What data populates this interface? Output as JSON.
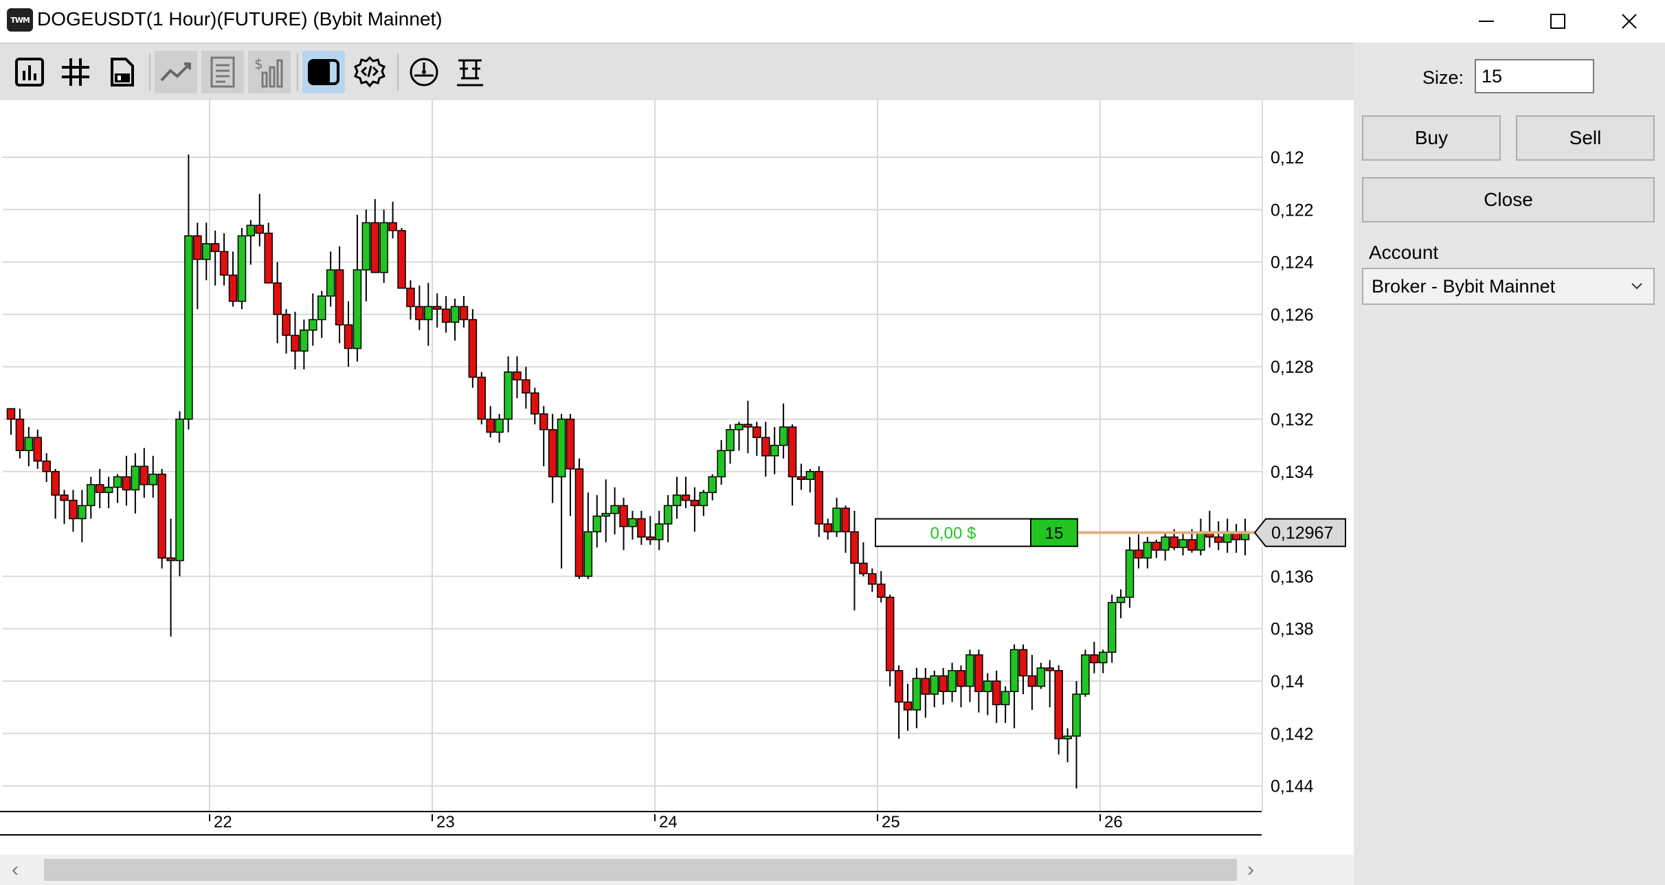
{
  "window": {
    "logo_text": "TWM",
    "title": "DOGEUSDT(1 Hour)(FUTURE) (Bybit Mainnet)"
  },
  "toolbar": {
    "buttons": [
      "bar-chart-icon",
      "grid-icon",
      "save-template-icon",
      "indicators-icon",
      "report-icon",
      "dollar-volume-icon",
      "panel-toggle-icon",
      "code-settings-icon",
      "speedometer-icon",
      "strategy-icon"
    ]
  },
  "chart": {
    "price_levels": [
      "0,144",
      "0,142",
      "0,14",
      "0,138",
      "0,136",
      "0,134",
      "0,132",
      "0,128",
      "0,126",
      "0,124",
      "0,122",
      "0,12"
    ],
    "current_price": "0,12967",
    "position": {
      "pnl": "0,00 $",
      "size": "15"
    },
    "colors": {
      "up": "#22c422",
      "down": "#e01010",
      "position_line": "#e0b080",
      "pnl_text": "#22c422"
    }
  },
  "chart_data": {
    "type": "candlestick",
    "instrument": "DOGEUSDT(1 Hour)(FUTURE)",
    "x_ticks": [
      "22",
      "23",
      "24",
      "25",
      "26"
    ],
    "ylim": [
      0.119,
      0.145
    ],
    "y_ticks": [
      0.12,
      0.122,
      0.124,
      0.126,
      0.128,
      0.132,
      0.134,
      0.136,
      0.138,
      0.14,
      0.142,
      0.144
    ],
    "last_price": 0.12967,
    "candles": [
      [
        0.1344,
        0.1344,
        0.1334,
        0.134
      ],
      [
        0.134,
        0.1344,
        0.1325,
        0.1328
      ],
      [
        0.1328,
        0.1337,
        0.1322,
        0.1333
      ],
      [
        0.1333,
        0.1336,
        0.1321,
        0.1324
      ],
      [
        0.1324,
        0.1327,
        0.1316,
        0.132
      ],
      [
        0.132,
        0.1321,
        0.1302,
        0.1311
      ],
      [
        0.1311,
        0.1313,
        0.13,
        0.1309
      ],
      [
        0.1309,
        0.1313,
        0.1297,
        0.1302
      ],
      [
        0.1302,
        0.1313,
        0.1293,
        0.1307
      ],
      [
        0.1307,
        0.1318,
        0.1302,
        0.1315
      ],
      [
        0.1315,
        0.1321,
        0.1306,
        0.1312
      ],
      [
        0.1312,
        0.1318,
        0.1306,
        0.1314
      ],
      [
        0.1314,
        0.1319,
        0.1308,
        0.1318
      ],
      [
        0.1318,
        0.1326,
        0.1307,
        0.1313
      ],
      [
        0.1313,
        0.1327,
        0.1304,
        0.1322
      ],
      [
        0.1322,
        0.1329,
        0.131,
        0.1315
      ],
      [
        0.1315,
        0.1326,
        0.131,
        0.1319
      ],
      [
        0.1319,
        0.1321,
        0.1283,
        0.1287
      ],
      [
        0.1287,
        0.1302,
        0.1257,
        0.1286
      ],
      [
        0.1286,
        0.1343,
        0.128,
        0.134
      ],
      [
        0.134,
        0.1441,
        0.1336,
        0.141
      ],
      [
        0.141,
        0.1415,
        0.1382,
        0.1401
      ],
      [
        0.1401,
        0.1415,
        0.1393,
        0.1407
      ],
      [
        0.1407,
        0.1412,
        0.1391,
        0.1404
      ],
      [
        0.1404,
        0.1411,
        0.1391,
        0.1395
      ],
      [
        0.1395,
        0.1404,
        0.1383,
        0.1385
      ],
      [
        0.1385,
        0.1413,
        0.1382,
        0.141
      ],
      [
        0.141,
        0.1416,
        0.1399,
        0.1414
      ],
      [
        0.1414,
        0.1426,
        0.1406,
        0.1411
      ],
      [
        0.1411,
        0.1415,
        0.1392,
        0.1392
      ],
      [
        0.1392,
        0.14,
        0.1369,
        0.138
      ],
      [
        0.138,
        0.1382,
        0.1365,
        0.1372
      ],
      [
        0.1372,
        0.1381,
        0.1359,
        0.1366
      ],
      [
        0.1366,
        0.1378,
        0.1359,
        0.1374
      ],
      [
        0.1374,
        0.1388,
        0.1368,
        0.1378
      ],
      [
        0.1378,
        0.1389,
        0.1371,
        0.1387
      ],
      [
        0.1387,
        0.1404,
        0.1383,
        0.1397
      ],
      [
        0.1397,
        0.1406,
        0.1369,
        0.1376
      ],
      [
        0.1376,
        0.1385,
        0.136,
        0.1367
      ],
      [
        0.1367,
        0.1418,
        0.1362,
        0.1397
      ],
      [
        0.1397,
        0.142,
        0.1385,
        0.1415
      ],
      [
        0.1415,
        0.1424,
        0.1406,
        0.1396
      ],
      [
        0.1396,
        0.142,
        0.1392,
        0.1415
      ],
      [
        0.1415,
        0.1423,
        0.1409,
        0.1412
      ],
      [
        0.1412,
        0.1413,
        0.139,
        0.139
      ],
      [
        0.139,
        0.1393,
        0.1378,
        0.1383
      ],
      [
        0.1383,
        0.1391,
        0.1374,
        0.1378
      ],
      [
        0.1378,
        0.1392,
        0.1368,
        0.1383
      ],
      [
        0.1383,
        0.1388,
        0.1375,
        0.1382
      ],
      [
        0.1382,
        0.1387,
        0.1373,
        0.1377
      ],
      [
        0.1377,
        0.1386,
        0.137,
        0.1383
      ],
      [
        0.1383,
        0.1387,
        0.1375,
        0.1378
      ],
      [
        0.1378,
        0.1382,
        0.1352,
        0.1356
      ],
      [
        0.1356,
        0.1358,
        0.1338,
        0.134
      ],
      [
        0.134,
        0.1345,
        0.1333,
        0.1335
      ],
      [
        0.1335,
        0.1342,
        0.1331,
        0.134
      ],
      [
        0.134,
        0.1364,
        0.1335,
        0.1358
      ],
      [
        0.1358,
        0.1364,
        0.1348,
        0.1355
      ],
      [
        0.1355,
        0.136,
        0.1344,
        0.135
      ],
      [
        0.135,
        0.1352,
        0.1338,
        0.1342
      ],
      [
        0.1342,
        0.1345,
        0.1322,
        0.1336
      ],
      [
        0.1336,
        0.1342,
        0.1308,
        0.1318
      ],
      [
        0.1318,
        0.1342,
        0.1283,
        0.134
      ],
      [
        0.134,
        0.1342,
        0.1303,
        0.1321
      ],
      [
        0.1321,
        0.1325,
        0.1279,
        0.128
      ],
      [
        0.128,
        0.1312,
        0.1279,
        0.1297
      ],
      [
        0.1297,
        0.1311,
        0.1291,
        0.1303
      ],
      [
        0.1303,
        0.1317,
        0.1293,
        0.1304
      ],
      [
        0.1304,
        0.1314,
        0.1296,
        0.1307
      ],
      [
        0.1307,
        0.131,
        0.129,
        0.1299
      ],
      [
        0.1299,
        0.1305,
        0.1294,
        0.1302
      ],
      [
        0.1302,
        0.1305,
        0.1292,
        0.1295
      ],
      [
        0.1295,
        0.1303,
        0.1292,
        0.1294
      ],
      [
        0.1294,
        0.1305,
        0.129,
        0.13
      ],
      [
        0.13,
        0.1311,
        0.1293,
        0.1307
      ],
      [
        0.1307,
        0.1318,
        0.1302,
        0.1311
      ],
      [
        0.1311,
        0.1318,
        0.1306,
        0.1309
      ],
      [
        0.1309,
        0.1314,
        0.1297,
        0.1307
      ],
      [
        0.1307,
        0.1313,
        0.1303,
        0.1312
      ],
      [
        0.1312,
        0.1319,
        0.1309,
        0.1318
      ],
      [
        0.1318,
        0.1332,
        0.1315,
        0.1328
      ],
      [
        0.1328,
        0.1338,
        0.1323,
        0.1336
      ],
      [
        0.1336,
        0.1339,
        0.1328,
        0.1338
      ],
      [
        0.1338,
        0.1347,
        0.1327,
        0.1337
      ],
      [
        0.1337,
        0.1339,
        0.1326,
        0.1333
      ],
      [
        0.1333,
        0.1339,
        0.1318,
        0.1326
      ],
      [
        0.1326,
        0.1337,
        0.1319,
        0.133
      ],
      [
        0.133,
        0.1346,
        0.1325,
        0.1337
      ],
      [
        0.1337,
        0.1338,
        0.1307,
        0.1318
      ],
      [
        0.1318,
        0.1323,
        0.1313,
        0.1317
      ],
      [
        0.1317,
        0.1321,
        0.1312,
        0.132
      ],
      [
        0.132,
        0.1322,
        0.1295,
        0.13
      ],
      [
        0.13,
        0.1302,
        0.1294,
        0.1297
      ],
      [
        0.1297,
        0.131,
        0.1295,
        0.1306
      ],
      [
        0.1306,
        0.1307,
        0.1289,
        0.1297
      ],
      [
        0.1297,
        0.1305,
        0.1267,
        0.1285
      ],
      [
        0.1285,
        0.1293,
        0.128,
        0.1281
      ],
      [
        0.1281,
        0.1283,
        0.1274,
        0.1277
      ],
      [
        0.1277,
        0.1282,
        0.127,
        0.1272
      ],
      [
        0.1272,
        0.1273,
        0.1238,
        0.1244
      ],
      [
        0.1244,
        0.1246,
        0.1218,
        0.1232
      ],
      [
        0.1232,
        0.1239,
        0.1221,
        0.1229
      ],
      [
        0.1229,
        0.1245,
        0.1222,
        0.1241
      ],
      [
        0.1241,
        0.1245,
        0.1226,
        0.1235
      ],
      [
        0.1235,
        0.1244,
        0.123,
        0.1242
      ],
      [
        0.1242,
        0.1245,
        0.1231,
        0.1236
      ],
      [
        0.1236,
        0.1247,
        0.1232,
        0.1244
      ],
      [
        0.1244,
        0.1246,
        0.123,
        0.1238
      ],
      [
        0.1238,
        0.1252,
        0.1232,
        0.125
      ],
      [
        0.125,
        0.1252,
        0.1228,
        0.1236
      ],
      [
        0.1236,
        0.1243,
        0.1227,
        0.124
      ],
      [
        0.124,
        0.1244,
        0.1224,
        0.1231
      ],
      [
        0.1231,
        0.1238,
        0.1224,
        0.1236
      ],
      [
        0.1236,
        0.1254,
        0.1222,
        0.1252
      ],
      [
        0.1252,
        0.1254,
        0.1235,
        0.1242
      ],
      [
        0.1242,
        0.125,
        0.1229,
        0.1238
      ],
      [
        0.1238,
        0.1247,
        0.1237,
        0.1245
      ],
      [
        0.1245,
        0.1248,
        0.123,
        0.1244
      ],
      [
        0.1244,
        0.1246,
        0.1212,
        0.1218
      ],
      [
        0.1218,
        0.1222,
        0.1209,
        0.1219
      ],
      [
        0.1219,
        0.124,
        0.1199,
        0.1235
      ],
      [
        0.1235,
        0.1252,
        0.1234,
        0.125
      ],
      [
        0.125,
        0.1255,
        0.1243,
        0.1247
      ],
      [
        0.1247,
        0.1252,
        0.1243,
        0.1251
      ],
      [
        0.1251,
        0.1273,
        0.1247,
        0.127
      ],
      [
        0.127,
        0.1275,
        0.1264,
        0.1272
      ],
      [
        0.1272,
        0.1295,
        0.1268,
        0.129
      ],
      [
        0.129,
        0.1296,
        0.1283,
        0.1287
      ],
      [
        0.1287,
        0.1295,
        0.1283,
        0.1293
      ],
      [
        0.1293,
        0.1294,
        0.1287,
        0.129
      ],
      [
        0.129,
        0.1297,
        0.1286,
        0.1295
      ],
      [
        0.1295,
        0.1298,
        0.129,
        0.1291
      ],
      [
        0.1291,
        0.1297,
        0.1288,
        0.1294
      ],
      [
        0.1294,
        0.1298,
        0.1289,
        0.129
      ],
      [
        0.129,
        0.1302,
        0.1288,
        0.1297
      ],
      [
        0.1297,
        0.1305,
        0.1291,
        0.1295
      ],
      [
        0.1295,
        0.1301,
        0.129,
        0.1293
      ],
      [
        0.1293,
        0.1302,
        0.1289,
        0.1297
      ],
      [
        0.1297,
        0.13,
        0.1289,
        0.1294
      ],
      [
        0.1294,
        0.1302,
        0.1288,
        0.1297
      ]
    ]
  },
  "panel": {
    "size_label": "Size:",
    "size_value": "15",
    "buy_label": "Buy",
    "sell_label": "Sell",
    "close_label": "Close",
    "account_label": "Account",
    "account_value": "Broker - Bybit Mainnet"
  }
}
